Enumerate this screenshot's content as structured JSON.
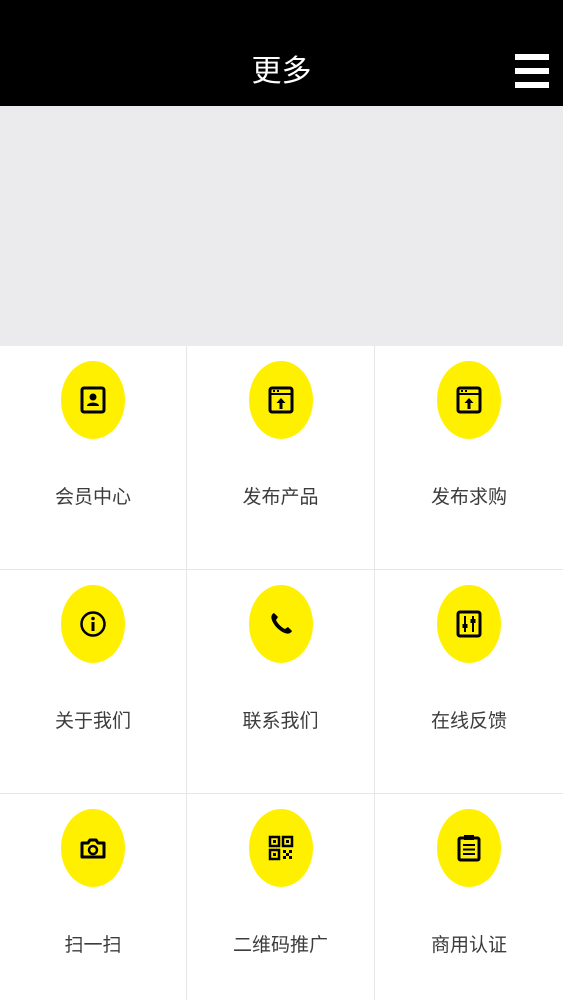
{
  "header": {
    "title": "更多",
    "menu_icon": "hamburger-menu-icon",
    "background": "#000000"
  },
  "accent_color": "#fff000",
  "grid": {
    "items": [
      {
        "label": "会员中心",
        "icon": "contact-card-icon"
      },
      {
        "label": "发布产品",
        "icon": "publish-upload-icon"
      },
      {
        "label": "发布求购",
        "icon": "publish-upload-icon"
      },
      {
        "label": "关于我们",
        "icon": "info-icon"
      },
      {
        "label": "联系我们",
        "icon": "phone-icon"
      },
      {
        "label": "在线反馈",
        "icon": "sliders-icon"
      },
      {
        "label": "扫一扫",
        "icon": "camera-icon"
      },
      {
        "label": "二维码推广",
        "icon": "qr-code-icon"
      },
      {
        "label": "商用认证",
        "icon": "clipboard-icon"
      }
    ]
  }
}
